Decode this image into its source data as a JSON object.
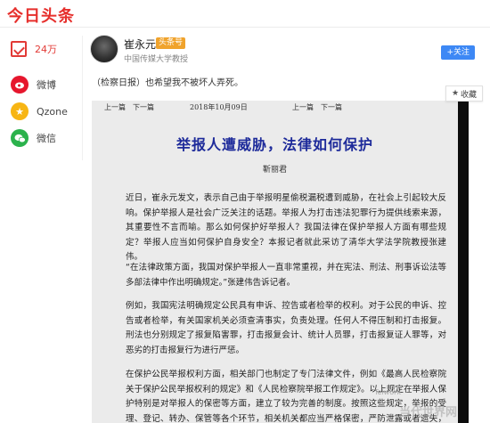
{
  "app": {
    "logo": "今日头条"
  },
  "sidebar": {
    "items": [
      {
        "icon": "thumbs-up-icon",
        "label": "24万"
      },
      {
        "icon": "weibo-icon",
        "label": "微博"
      },
      {
        "icon": "qzone-icon",
        "label": "Qzone"
      },
      {
        "icon": "wechat-icon",
        "label": "微信"
      }
    ]
  },
  "author": {
    "name": "崔永元",
    "badge": "头条号",
    "description": "中国传媒大学教授",
    "follow_label": "+关注"
  },
  "post": {
    "lead": "（检察日报）也希望我不被坏人弄死。",
    "collect_label": "收藏"
  },
  "article": {
    "nav_left": "上一篇　下一篇",
    "date": "2018年10月09日",
    "nav_right": "上一篇　下一篇",
    "headline": "举报人遭威胁，法律如何保护",
    "byline": "靳丽君",
    "paragraphs": [
      "近日，崔永元发文，表示自己由于举报明星偷税漏税遭到威胁，在社会上引起较大反响。保护举报人是社会广泛关注的话题。举报人为打击违法犯罪行为提供线索来源，其重要性不言而喻。那么如何保护好举报人？我国法律在保护举报人方面有哪些规定？举报人应当如何保护自身安全？本报记者就此采访了清华大学法学院教授张建伟。",
      "“在法律政策方面，我国对保护举报人一直非常重视，并在宪法、刑法、刑事诉讼法等多部法律中作出明确规定。”张建伟告诉记者。",
      "例如，我国宪法明确规定公民具有申诉、控告或者检举的权利。对于公民的申诉、控告或者检举，有关国家机关必须查清事实，负责处理。任何人不得压制和打击报复。刑法也分别规定了报复陷害罪，打击报复会计、统计人员罪，打击报复证人罪等，对恶劣的打击报复行为进行严惩。",
      "在保护公民举报权利方面，相关部门也制定了专门法律文件，例如《最高人民检察院关于保护公民举报权利的规定》和《人民检察院举报工作规定》。以上规定在举报人保护特别是对举报人的保密等方面，建立了较为完善的制度。按照这些规定，举报的受理、登记、转办、保管等各个环节，相关机关都应当严格保密，严防泄露或者遗失，不准私自摘抄、复制、扣押、销毁举报材料。"
    ]
  },
  "watermarks": {
    "small": "Telwork",
    "large": "当代世界网"
  },
  "colors": {
    "brand": "#e62f2c",
    "headline": "#1d2a9a",
    "follow": "#3d88f5",
    "badge": "#f0a32c"
  }
}
